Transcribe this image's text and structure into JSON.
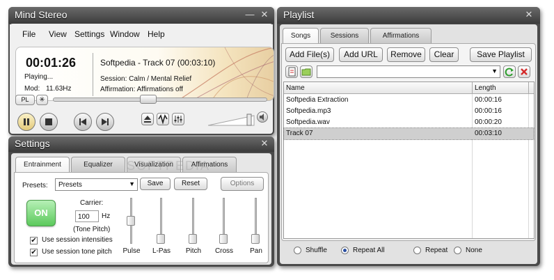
{
  "player": {
    "title": "Mind Stereo",
    "menu": [
      "File",
      "View",
      "Settings",
      "Window",
      "Help"
    ],
    "time": "00:01:26",
    "status": "Playing...",
    "mod_label": "Mod:",
    "mod_value": "11.63Hz",
    "track": "Softpedia - Track 07 (00:03:10)",
    "session": "Session: Calm / Mental Relief",
    "affirmation": "Affirmation: Affirmations off",
    "pl_label": "PL",
    "seek_progress": 0.44,
    "volume_level": 0.9
  },
  "settings": {
    "title": "Settings",
    "tabs": [
      "Entrainment",
      "Equalizer",
      "Visualization",
      "Affirmations"
    ],
    "active_tab": "Entrainment",
    "presets_label": "Presets:",
    "presets_value": "Presets",
    "save_label": "Save",
    "reset_label": "Reset",
    "options_label": "Options",
    "on_label": "ON",
    "carrier_label": "Carrier:",
    "carrier_value": "100",
    "hz_label": "Hz",
    "tone_pitch_label": "(Tone Pitch)",
    "use_intensities": "Use session intensities",
    "use_tone_pitch": "Use session tone pitch",
    "sliders": [
      {
        "label": "Pulse",
        "level": 0.5
      },
      {
        "label": "L-Pas",
        "level": 0.0
      },
      {
        "label": "Pitch",
        "level": 0.0
      },
      {
        "label": "Cross",
        "level": 0.0
      },
      {
        "label": "Pan",
        "level": 0.0
      }
    ]
  },
  "playlist": {
    "title": "Playlist",
    "tabs": [
      "Songs",
      "Sessions",
      "Affirmations"
    ],
    "active_tab": "Songs",
    "buttons": {
      "add_files": "Add File(s)",
      "add_url": "Add URL",
      "remove": "Remove",
      "clear": "Clear",
      "save_playlist": "Save Playlist"
    },
    "columns": [
      "Name",
      "Length"
    ],
    "rows": [
      {
        "name": "Softpedia Extraction",
        "length": "00:00:16"
      },
      {
        "name": "Softpedia.mp3",
        "length": "00:00:16"
      },
      {
        "name": "Softpedia.wav",
        "length": "00:00:20"
      },
      {
        "name": "Track 07",
        "length": "00:03:10"
      }
    ],
    "selected_row": 3,
    "modes": [
      "Shuffle",
      "Repeat All",
      "Repeat",
      "None"
    ],
    "selected_mode": "Repeat All"
  },
  "watermark": "SOFTPEDIA",
  "colors": {
    "frame": "#4a4a4a",
    "on_button": "#6ed36e",
    "refresh_icon": "#2e9e2e",
    "delete_icon": "#d42a2a"
  }
}
